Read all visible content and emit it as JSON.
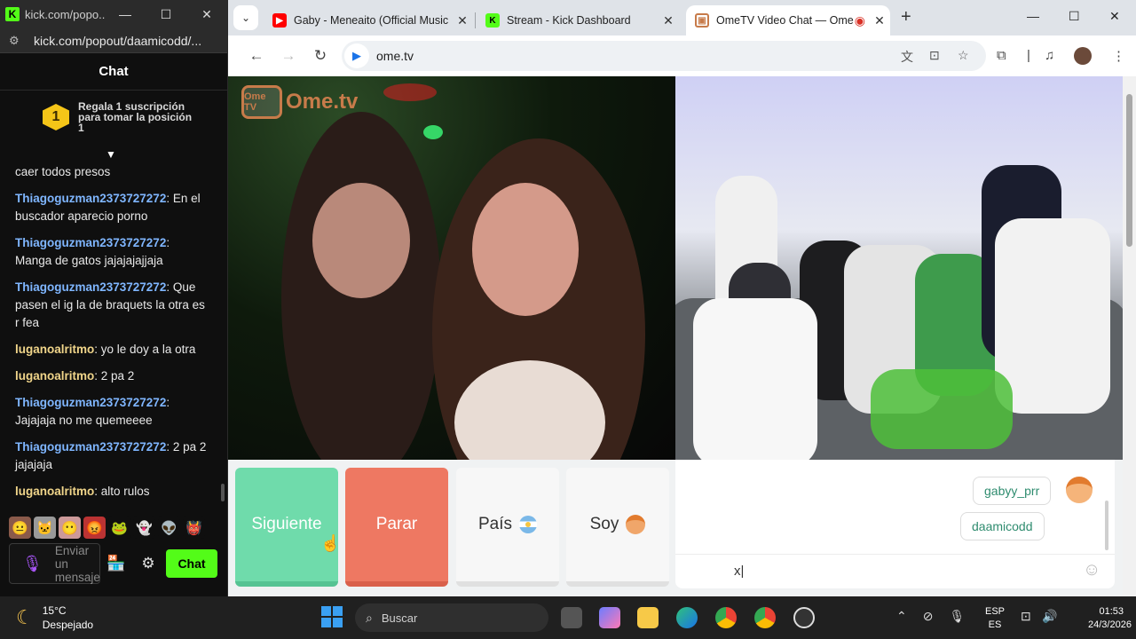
{
  "kick_window": {
    "title": "kick.com/popo...",
    "url": "kick.com/popout/daamicodd/...",
    "header": "Chat",
    "sub_promo": "Regala 1 suscripción para tomar la posición 1",
    "sub_rank": "1",
    "messages": [
      {
        "user": "",
        "text": "caer todos presos",
        "color": "#ffffff"
      },
      {
        "user": "Thiagoguzman2373727272",
        "text": "En el buscador aparecio porno",
        "color": "#7fb6ff"
      },
      {
        "user": "Thiagoguzman2373727272",
        "text": "Manga de gatos jajajajajjaja",
        "color": "#7fb6ff"
      },
      {
        "user": "Thiagoguzman2373727272",
        "text": "Que pasen el ig la de braquets la otra es r fea",
        "color": "#7fb6ff"
      },
      {
        "user": "luganoalritmo",
        "text": "yo le doy a la otra",
        "color": "#f0d58a"
      },
      {
        "user": "luganoalritmo",
        "text": "2 pa 2",
        "color": "#f0d58a"
      },
      {
        "user": "Thiagoguzman2373727272",
        "text": "Jajajaja no me quemeeee",
        "color": "#7fb6ff"
      },
      {
        "user": "Thiagoguzman2373727272",
        "text": "2 pa 2 jajajaja",
        "color": "#7fb6ff"
      },
      {
        "user": "luganoalritmo",
        "text": "alto rulos",
        "color": "#f0d58a"
      }
    ],
    "input_placeholder": "Enviar un mensaje",
    "send_label": "Chat"
  },
  "chrome": {
    "tabs": [
      {
        "title": "Gaby - Meneaito (Official Music",
        "icon": "youtube-icon"
      },
      {
        "title": "Stream - Kick Dashboard",
        "icon": "kick-icon"
      },
      {
        "title": "OmeTV Video Chat — Ome",
        "icon": "ometv-icon",
        "active": true
      }
    ],
    "url": "ome.tv"
  },
  "ometv": {
    "logo_text": "Ome.tv",
    "logo_tv_text": "Ome TV",
    "buttons": {
      "next": "Siguiente",
      "stop": "Parar",
      "country": "País",
      "gender": "Soy"
    },
    "chat": {
      "messages": [
        "gabyy_prr",
        "daamicodd"
      ],
      "input_value": "x"
    }
  },
  "taskbar": {
    "weather_temp": "15°C",
    "weather_desc": "Despejado",
    "search_placeholder": "Buscar",
    "lang_top": "ESP",
    "lang_bottom": "ES",
    "time": "01:53",
    "date": "24/3/2026"
  },
  "colors": {
    "kick_green": "#53fc18",
    "next_green": "#6fdbab",
    "stop_red": "#ee7862"
  }
}
